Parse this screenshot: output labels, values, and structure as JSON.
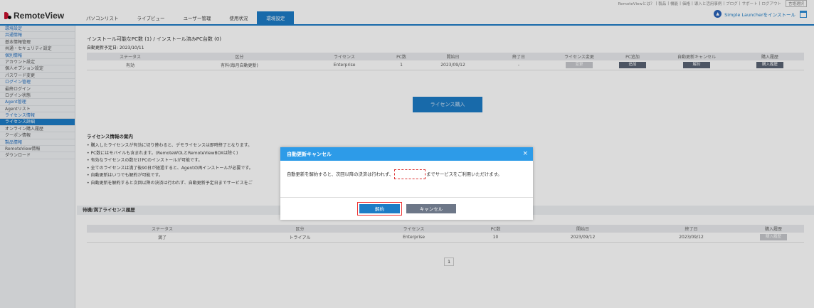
{
  "topbar": {
    "links": [
      "RemoteViewとは？",
      "製品",
      "機能",
      "価格",
      "導入と活用事例",
      "ブログ",
      "サポート",
      "ログアウト"
    ],
    "language": "言語選択"
  },
  "header": {
    "logo_text": "RemoteView",
    "nav": [
      {
        "label": "パソコンリスト",
        "active": false
      },
      {
        "label": "ライブビュー",
        "active": false
      },
      {
        "label": "ユーザー管理",
        "active": false
      },
      {
        "label": "使用状況",
        "active": false
      },
      {
        "label": "環境設定",
        "active": true
      }
    ],
    "install_label": "Simple Launcherをインストール"
  },
  "sidebar": {
    "items": [
      {
        "label": "環境設定",
        "type": "cat"
      },
      {
        "label": "共通情報",
        "type": "cat"
      },
      {
        "label": "基本情報管理",
        "type": "item"
      },
      {
        "label": "共通・セキュリティ設定",
        "type": "item"
      },
      {
        "label": "個別情報",
        "type": "cat"
      },
      {
        "label": "アカウント設定",
        "type": "item"
      },
      {
        "label": "個人オプション設定",
        "type": "item"
      },
      {
        "label": "パスワード変更",
        "type": "item"
      },
      {
        "label": "ログイン管理",
        "type": "cat"
      },
      {
        "label": "最終ログイン",
        "type": "item"
      },
      {
        "label": "ログイン状態",
        "type": "item"
      },
      {
        "label": "Agent管理",
        "type": "cat"
      },
      {
        "label": "Agentリスト",
        "type": "item"
      },
      {
        "label": "ライセンス情報",
        "type": "cat"
      },
      {
        "label": "ライセンス詳細",
        "type": "active"
      },
      {
        "label": "オンライン購入履歴",
        "type": "item"
      },
      {
        "label": "クーポン情報",
        "type": "item"
      },
      {
        "label": "製品情報",
        "type": "cat"
      },
      {
        "label": "RemoteView情報",
        "type": "item"
      },
      {
        "label": "ダウンロード",
        "type": "item"
      }
    ]
  },
  "license": {
    "title": "インストール可能なPC数 (1) / インストール済みPC台数 (0)",
    "renewal_date": "自動更新予定日: 2023/10/11",
    "headers": [
      "ステータス",
      "区分",
      "ライセンス",
      "PC数",
      "開始日",
      "終了日",
      "ライセンス変更",
      "PC追加",
      "自動更新キャンセル",
      "購入履歴"
    ],
    "row": {
      "status": "有効",
      "category": "有料(毎月自動更新)",
      "license": "Enterprise",
      "pc_count": "1",
      "start": "2023/09/12",
      "end": "-",
      "change_btn": "変更",
      "add_btn": "追加",
      "cancel_btn": "解約",
      "history_btn": "購入履歴"
    },
    "purchase_button": "ライセンス購入"
  },
  "guide": {
    "title": "ライセンス情報の案内",
    "lines": [
      "• 購入したライセンスが有効に切り替わると、デモライセンスは即時終了となります。",
      "• PC数にはモバイルも含まれます。(RemoteWOLとRemoteViewBOXは除く)",
      "• 有効なライセンスの数だけPCのインストールが可能です。",
      "• 全てのライセンスは満了後90日が経過すると、Agentの再インストールが必要です。",
      "• 自動更新はいつでも解約が可能です。",
      "• 自動更新を解約すると次回以降の決済は行われず、自動更新予定日までサービスをご"
    ]
  },
  "history": {
    "title": "待機/満了ライセンス履歴",
    "headers": [
      "ステータス",
      "区分",
      "ライセンス",
      "PC数",
      "開始日",
      "終了日",
      "購入履歴"
    ],
    "row": {
      "status": "満了",
      "category": "トライアル",
      "license": "Enterprise",
      "pc_count": "10",
      "start": "2023/09/12",
      "end": "2023/09/12",
      "history_btn": "購入履歴"
    },
    "page": "1"
  },
  "modal": {
    "title": "自動更新キャンセル",
    "close": "×",
    "message_before": "自動更新を解約すると、次回以降の決済は行われず、",
    "message_after": "までサービスをご利用いただけます。",
    "confirm": "解約",
    "cancel": "キャンセル"
  },
  "colors": {
    "accent": "#1c7cc6",
    "modal_header": "#2d9be8",
    "highlight": "#e33333"
  }
}
